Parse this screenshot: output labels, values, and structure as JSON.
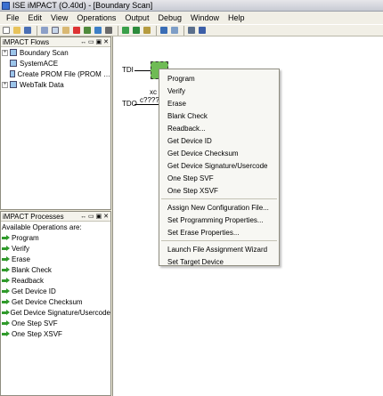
{
  "window": {
    "title": "ISE iMPACT (O.40d) - [Boundary Scan]"
  },
  "menubar": [
    "File",
    "Edit",
    "View",
    "Operations",
    "Output",
    "Debug",
    "Window",
    "Help"
  ],
  "flows_panel": {
    "title": "iMPACT Flows",
    "header_buttons": "↔ ▭ ▣ ✕",
    "items": [
      {
        "label": "Boundary Scan",
        "expander": "+"
      },
      {
        "label": "SystemACE",
        "expander": ""
      },
      {
        "label": "Create PROM File (PROM …",
        "expander": ""
      },
      {
        "label": "WebTalk Data",
        "expander": "+"
      }
    ]
  },
  "processes_panel": {
    "title": "iMPACT Processes",
    "header_buttons": "↔ ▭ ▣ ✕",
    "caption": "Available Operations are:",
    "operations": [
      "Program",
      "Verify",
      "Erase",
      "Blank Check",
      "Readback",
      "Get Device ID",
      "Get Device Checksum",
      "Get Device Signature/Usercode",
      "One Step SVF",
      "One Step XSVF"
    ]
  },
  "canvas": {
    "tdi": "TDI",
    "tdo": "TDO",
    "chip_label": "xc",
    "chip_file": "c????_"
  },
  "context_menu": {
    "group1": [
      "Program",
      "Verify",
      "Erase",
      "Blank Check",
      "Readback...",
      "Get Device ID",
      "Get Device Checksum",
      "Get Device Signature/Usercode",
      "One Step SVF",
      "One Step XSVF"
    ],
    "group2": [
      "Assign New Configuration File...",
      "Set Programming Properties...",
      "Set Erase Properties..."
    ],
    "group3": [
      "Launch File Assignment Wizard",
      "Set Target Device"
    ]
  }
}
